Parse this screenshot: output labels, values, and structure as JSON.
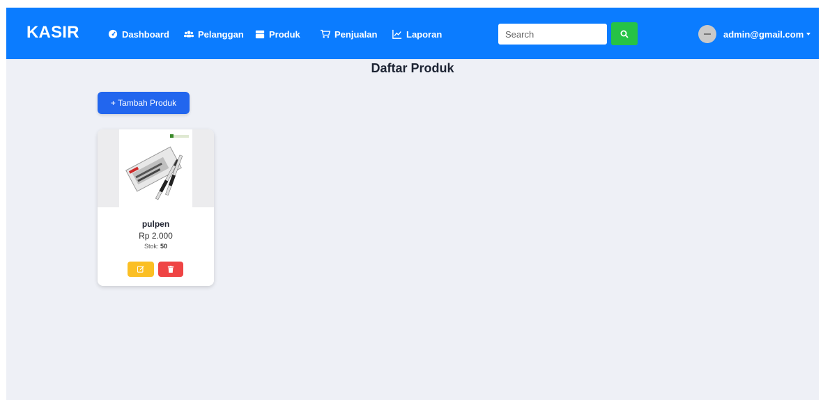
{
  "navbar": {
    "brand": "KASIR",
    "items": [
      {
        "label": "Dashboard",
        "icon": "tachometer-icon"
      },
      {
        "label": "Pelanggan",
        "icon": "users-icon"
      },
      {
        "label": "Produk",
        "icon": "box-icon"
      },
      {
        "label": "Penjualan",
        "icon": "cart-icon"
      },
      {
        "label": "Laporan",
        "icon": "chart-line-icon"
      }
    ],
    "search": {
      "placeholder": "Search",
      "value": ""
    },
    "user": {
      "email": "admin@gmail.com"
    }
  },
  "main": {
    "title": "Daftar Produk",
    "add_button_label": "+ Tambah Produk"
  },
  "products": [
    {
      "name": "pulpen",
      "price": "Rp 2.000",
      "stock_label": "Stok:",
      "stock_value": "50"
    }
  ],
  "colors": {
    "navbar": "#0b7cff",
    "search_button": "#26c346",
    "add_button": "#2266ee",
    "edit_button": "#fbbf24",
    "delete_button": "#ef4444",
    "page_bg": "#eef0f6"
  }
}
